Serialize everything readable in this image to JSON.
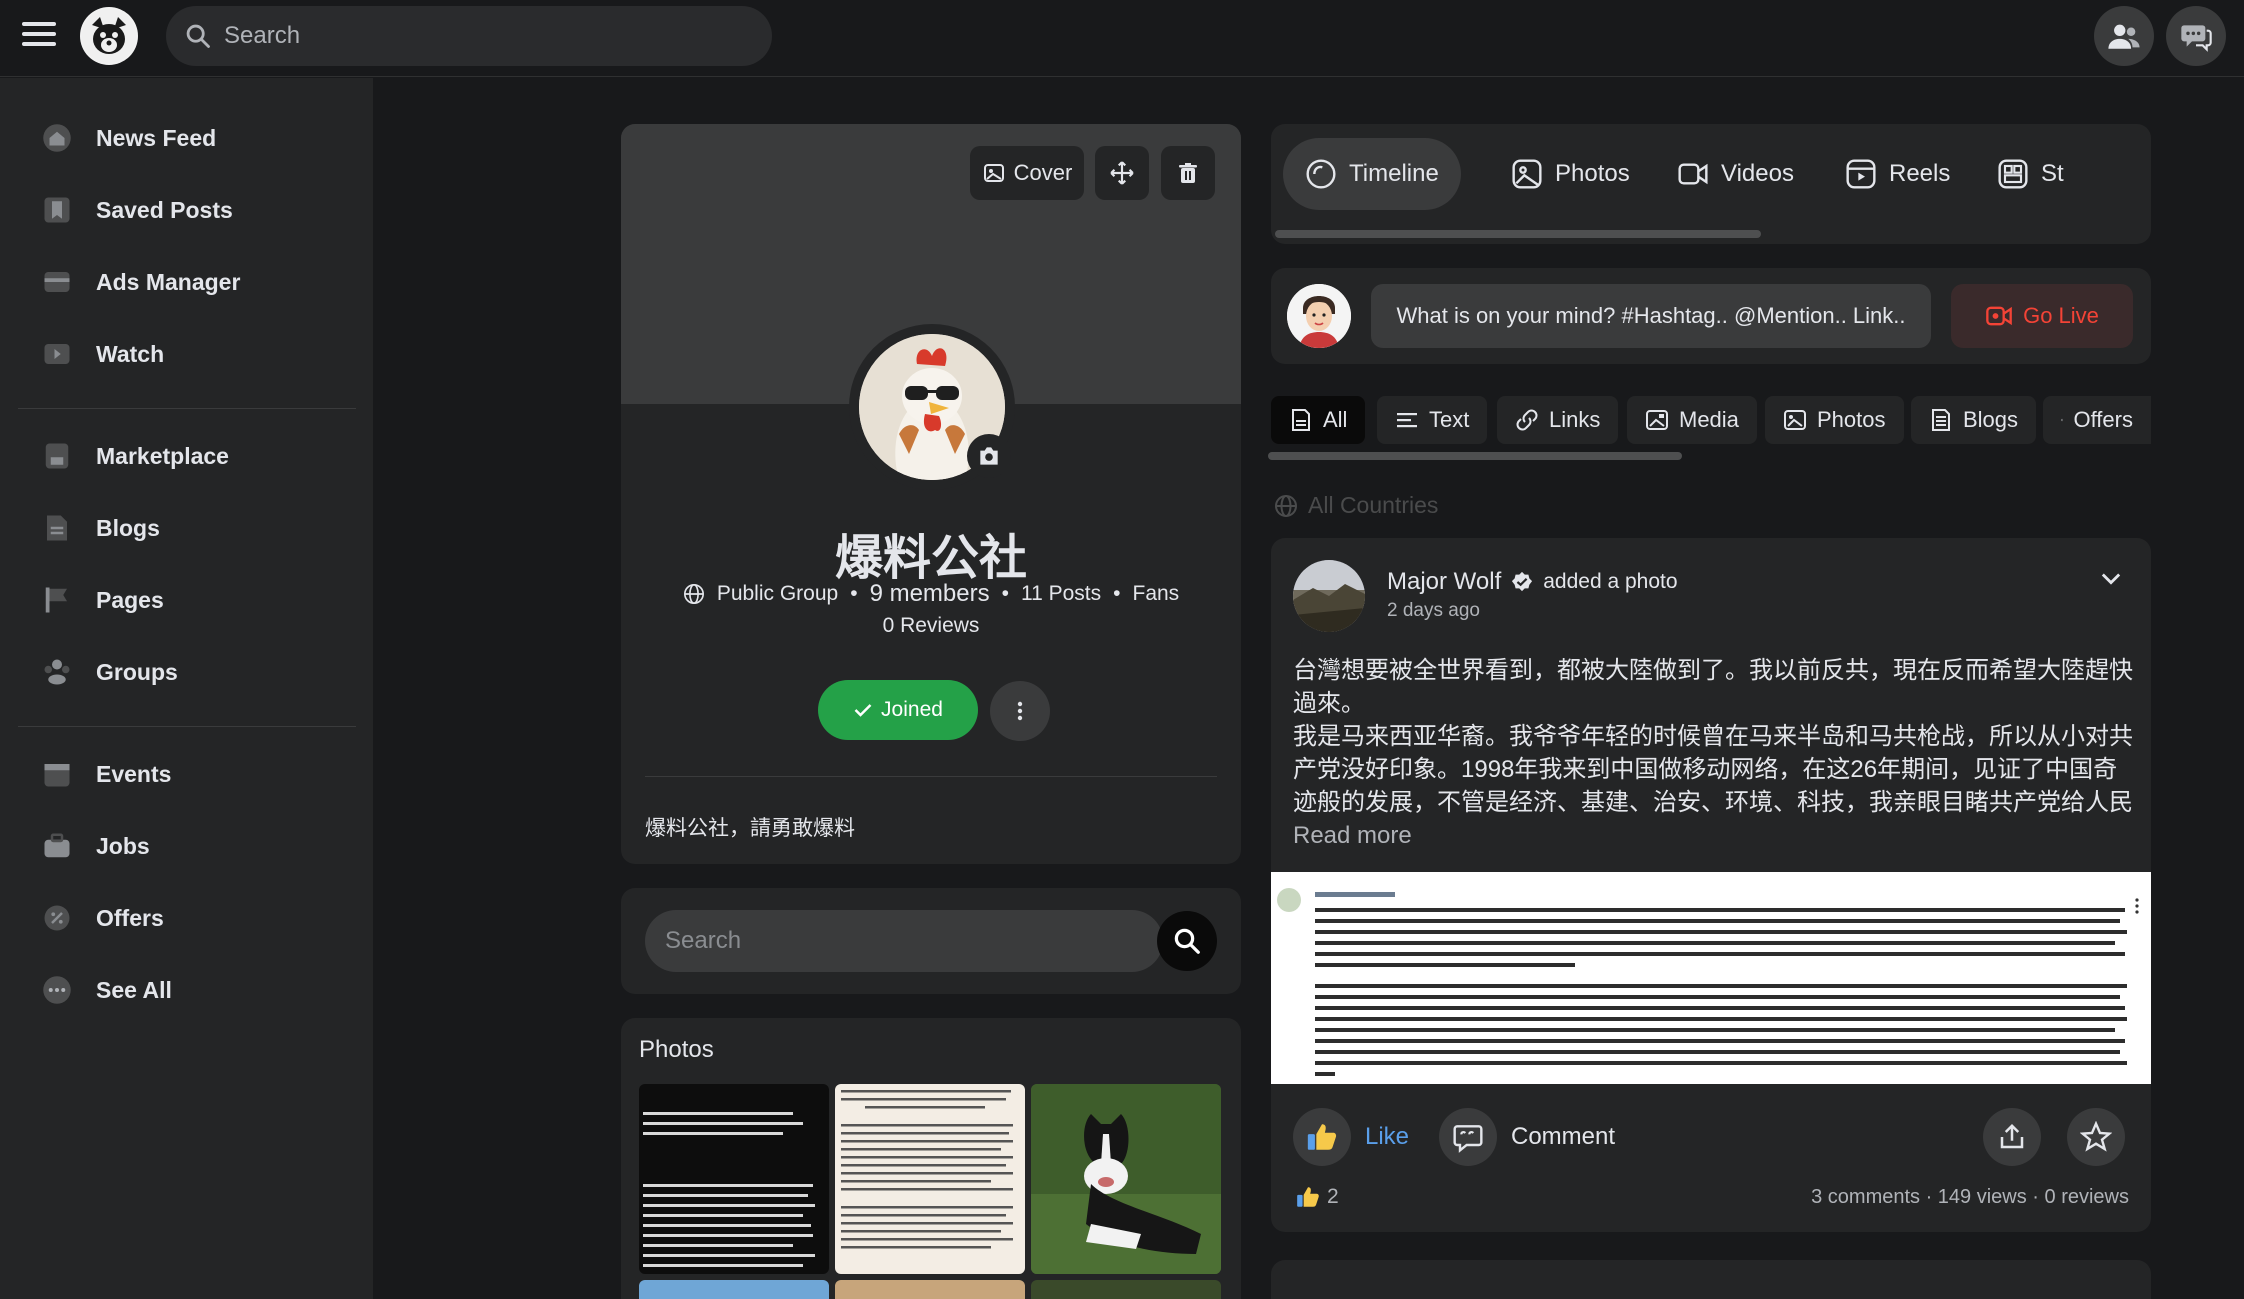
{
  "topbar": {
    "search_placeholder": "Search"
  },
  "sidebar": {
    "items": [
      {
        "label": "News Feed",
        "icon": "house-icon"
      },
      {
        "label": "Saved Posts",
        "icon": "bookmark-icon"
      },
      {
        "label": "Ads Manager",
        "icon": "ads-icon"
      },
      {
        "label": "Watch",
        "icon": "video-icon"
      },
      {
        "label": "Marketplace",
        "icon": "store-icon"
      },
      {
        "label": "Blogs",
        "icon": "document-icon"
      },
      {
        "label": "Pages",
        "icon": "flag-icon"
      },
      {
        "label": "Groups",
        "icon": "people-icon"
      },
      {
        "label": "Events",
        "icon": "calendar-icon"
      },
      {
        "label": "Jobs",
        "icon": "briefcase-icon"
      },
      {
        "label": "Offers",
        "icon": "badge-icon"
      },
      {
        "label": "See All",
        "icon": "more-dots-icon"
      }
    ]
  },
  "group": {
    "cover_label": "Cover",
    "name": "爆料公社",
    "privacy": "Public Group",
    "members": "9 members",
    "posts": "11 Posts",
    "fans": "Fans",
    "reviews": "0 Reviews",
    "joined_label": "Joined",
    "description": "爆料公社，請勇敢爆料",
    "search_placeholder": "Search",
    "photos_title": "Photos"
  },
  "tabs": [
    {
      "label": "Timeline",
      "active": true
    },
    {
      "label": "Photos"
    },
    {
      "label": "Videos"
    },
    {
      "label": "Reels"
    },
    {
      "label": "St"
    }
  ],
  "composer": {
    "placeholder": "What is on your mind? #Hashtag.. @Mention.. Link..",
    "go_live": "Go Live"
  },
  "filters": [
    {
      "label": "All",
      "active": true
    },
    {
      "label": "Text"
    },
    {
      "label": "Links"
    },
    {
      "label": "Media"
    },
    {
      "label": "Photos"
    },
    {
      "label": "Blogs"
    },
    {
      "label": "Offers"
    }
  ],
  "countries_label": "All Countries",
  "post": {
    "author": "Major Wolf",
    "action": "added a photo",
    "time": "2 days ago",
    "text": "台灣想要被全世界看到，都被大陸做到了。我以前反共，現在反而希望大陸趕快過來。\n我是马来西亚华裔。我爷爷年轻的时候曾在马来半岛和马共枪战，所以从小对共产党没好印象。1998年我来到中国做移动网络，在这26年期间，见证了中国奇迹般的发展，不管是经济、基建、治安、环境、科技，我亲眼目睹共产党给人民做的一切。除",
    "read_more": "Read more",
    "like_label": "Like",
    "comment_label": "Comment",
    "reaction_count": "2",
    "stats": "3 comments · 149 views · 0 reviews"
  },
  "colors": {
    "accent_green": "#24a148",
    "live_red": "#f44336",
    "like_blue": "#5a9fea"
  }
}
